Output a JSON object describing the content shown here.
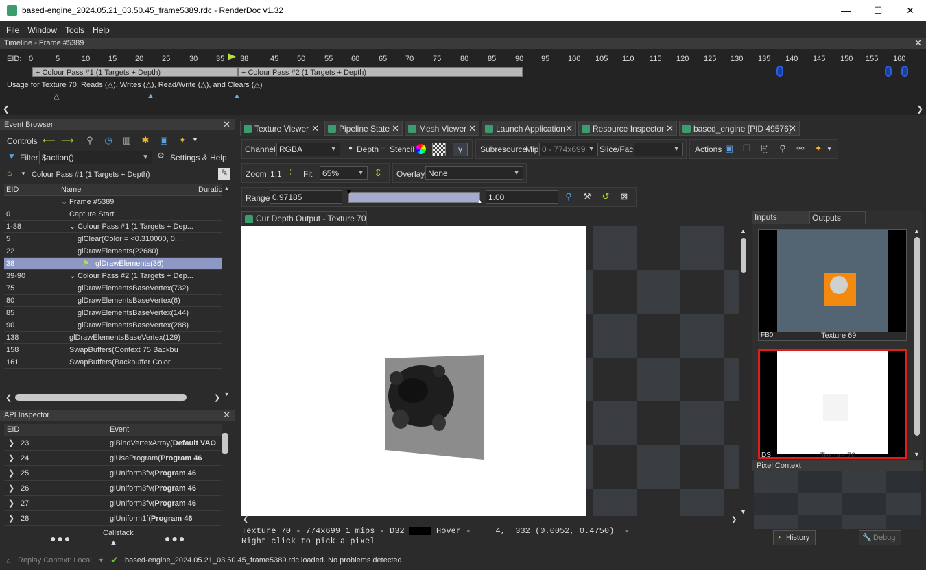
{
  "window": {
    "title": "based-engine_2024.05.21_03.50.45_frame5389.rdc - RenderDoc v1.32",
    "min": "—",
    "max": "☐",
    "close": "✕"
  },
  "menu": [
    "File",
    "Window",
    "Tools",
    "Help"
  ],
  "timeline": {
    "title": "Timeline - Frame #5389",
    "eid_label": "EID:",
    "ticks": [
      "0",
      "5",
      "10",
      "15",
      "20",
      "25",
      "30",
      "35",
      "38",
      "45",
      "50",
      "55",
      "60",
      "65",
      "70",
      "75",
      "80",
      "85",
      "90",
      "95",
      "100",
      "105",
      "110",
      "115",
      "120",
      "125",
      "130",
      "135",
      "140",
      "145",
      "150",
      "155",
      "160"
    ],
    "passes": [
      "+ Colour Pass #1 (1 Targets + Depth)",
      "+ Colour Pass #2 (1 Targets + Depth)"
    ],
    "usage": "Usage for Texture 70: Reads (△), Writes (△), Read/Write (△), and Clears (△)"
  },
  "event_browser": {
    "title": "Event Browser",
    "controls_label": "Controls",
    "filter_label": "Filter",
    "filter_value": "$action()",
    "settings_label": "Settings & Help",
    "breadcrumb": "Colour Pass #1 (1 Targets + Depth)",
    "columns": [
      "EID",
      "Name",
      "Duratio"
    ],
    "rows": [
      {
        "eid": "",
        "name": "Frame #5389"
      },
      {
        "eid": "0",
        "name": "Capture Start"
      },
      {
        "eid": "1-38",
        "name": "Colour Pass #1 (1 Targets + Dep..."
      },
      {
        "eid": "5",
        "name": "glClear(Color = <0.310000, 0...."
      },
      {
        "eid": "22",
        "name": "glDrawElements(22680)"
      },
      {
        "eid": "38",
        "name": "glDrawElements(36)"
      },
      {
        "eid": "39-90",
        "name": "Colour Pass #2 (1 Targets + Dep..."
      },
      {
        "eid": "75",
        "name": "glDrawElementsBaseVertex(732)"
      },
      {
        "eid": "80",
        "name": "glDrawElementsBaseVertex(6)"
      },
      {
        "eid": "85",
        "name": "glDrawElementsBaseVertex(144)"
      },
      {
        "eid": "90",
        "name": "glDrawElementsBaseVertex(288)"
      },
      {
        "eid": "138",
        "name": "glDrawElementsBaseVertex(129)"
      },
      {
        "eid": "158",
        "name": "SwapBuffers(Context 75 Backbu"
      },
      {
        "eid": "161",
        "name": "SwapBuffers(Backbuffer Color"
      }
    ]
  },
  "api_inspector": {
    "title": "API Inspector",
    "columns": [
      "EID",
      "Event"
    ],
    "rows": [
      {
        "eid": "23",
        "event": "glBindVertexArray(Default VAO"
      },
      {
        "eid": "24",
        "event": "glUseProgram(Program 46"
      },
      {
        "eid": "25",
        "event": "glUniform3fv(Program 46"
      },
      {
        "eid": "26",
        "event": "glUniform3fv(Program 46"
      },
      {
        "eid": "27",
        "event": "glUniform3fv(Program 46"
      },
      {
        "eid": "28",
        "event": "glUniform1f(Program 46"
      }
    ],
    "callstack_label": "Callstack"
  },
  "tabs": [
    "Texture Viewer",
    "Pipeline State",
    "Mesh Viewer",
    "Launch Application",
    "Resource Inspector",
    "based_engine [PID 49576]"
  ],
  "texture_viewer": {
    "channels_label": "Channels",
    "channels_value": "RGBA",
    "depth_label": "Depth",
    "stencil_label": "Stencil",
    "gamma_label": "γ",
    "subresource_label": "Subresource",
    "mip_label": "Mip",
    "mip_value": "0 - 774x699",
    "slice_label": "Slice/Face",
    "actions_label": "Actions",
    "zoom_label": "Zoom",
    "zoom_11": "1:1",
    "fit_label": "Fit",
    "zoom_value": "65%",
    "overlay_label": "Overlay",
    "overlay_value": "None",
    "range_label": "Range",
    "range_min": "0.97185",
    "range_max": "1.00",
    "view_tab": "Cur Depth Output - Texture 70",
    "status_line1": "Texture 70 - 774x699 1 mips - D32",
    "status_hover": "Hover -     4,  332 (0.0052, 0.4750)  -",
    "status_line2": "Right click to pick a pixel"
  },
  "outputs_panel": {
    "tabs": [
      "Inputs",
      "Outputs"
    ],
    "thumbs": [
      {
        "left": "FB0",
        "right": "Texture 69"
      },
      {
        "left": "DS",
        "right": "Texture 70"
      }
    ]
  },
  "pixel_context": {
    "title": "Pixel Context",
    "history": "History",
    "debug": "Debug"
  },
  "statusbar": {
    "replay": "Replay Context: Local",
    "message": "based-engine_2024.05.21_03.50.45_frame5389.rdc loaded. No problems detected."
  },
  "colors": {
    "accent": "#3b9c6e",
    "selection": "#8e98c5",
    "red_border": "#e21b1b"
  }
}
